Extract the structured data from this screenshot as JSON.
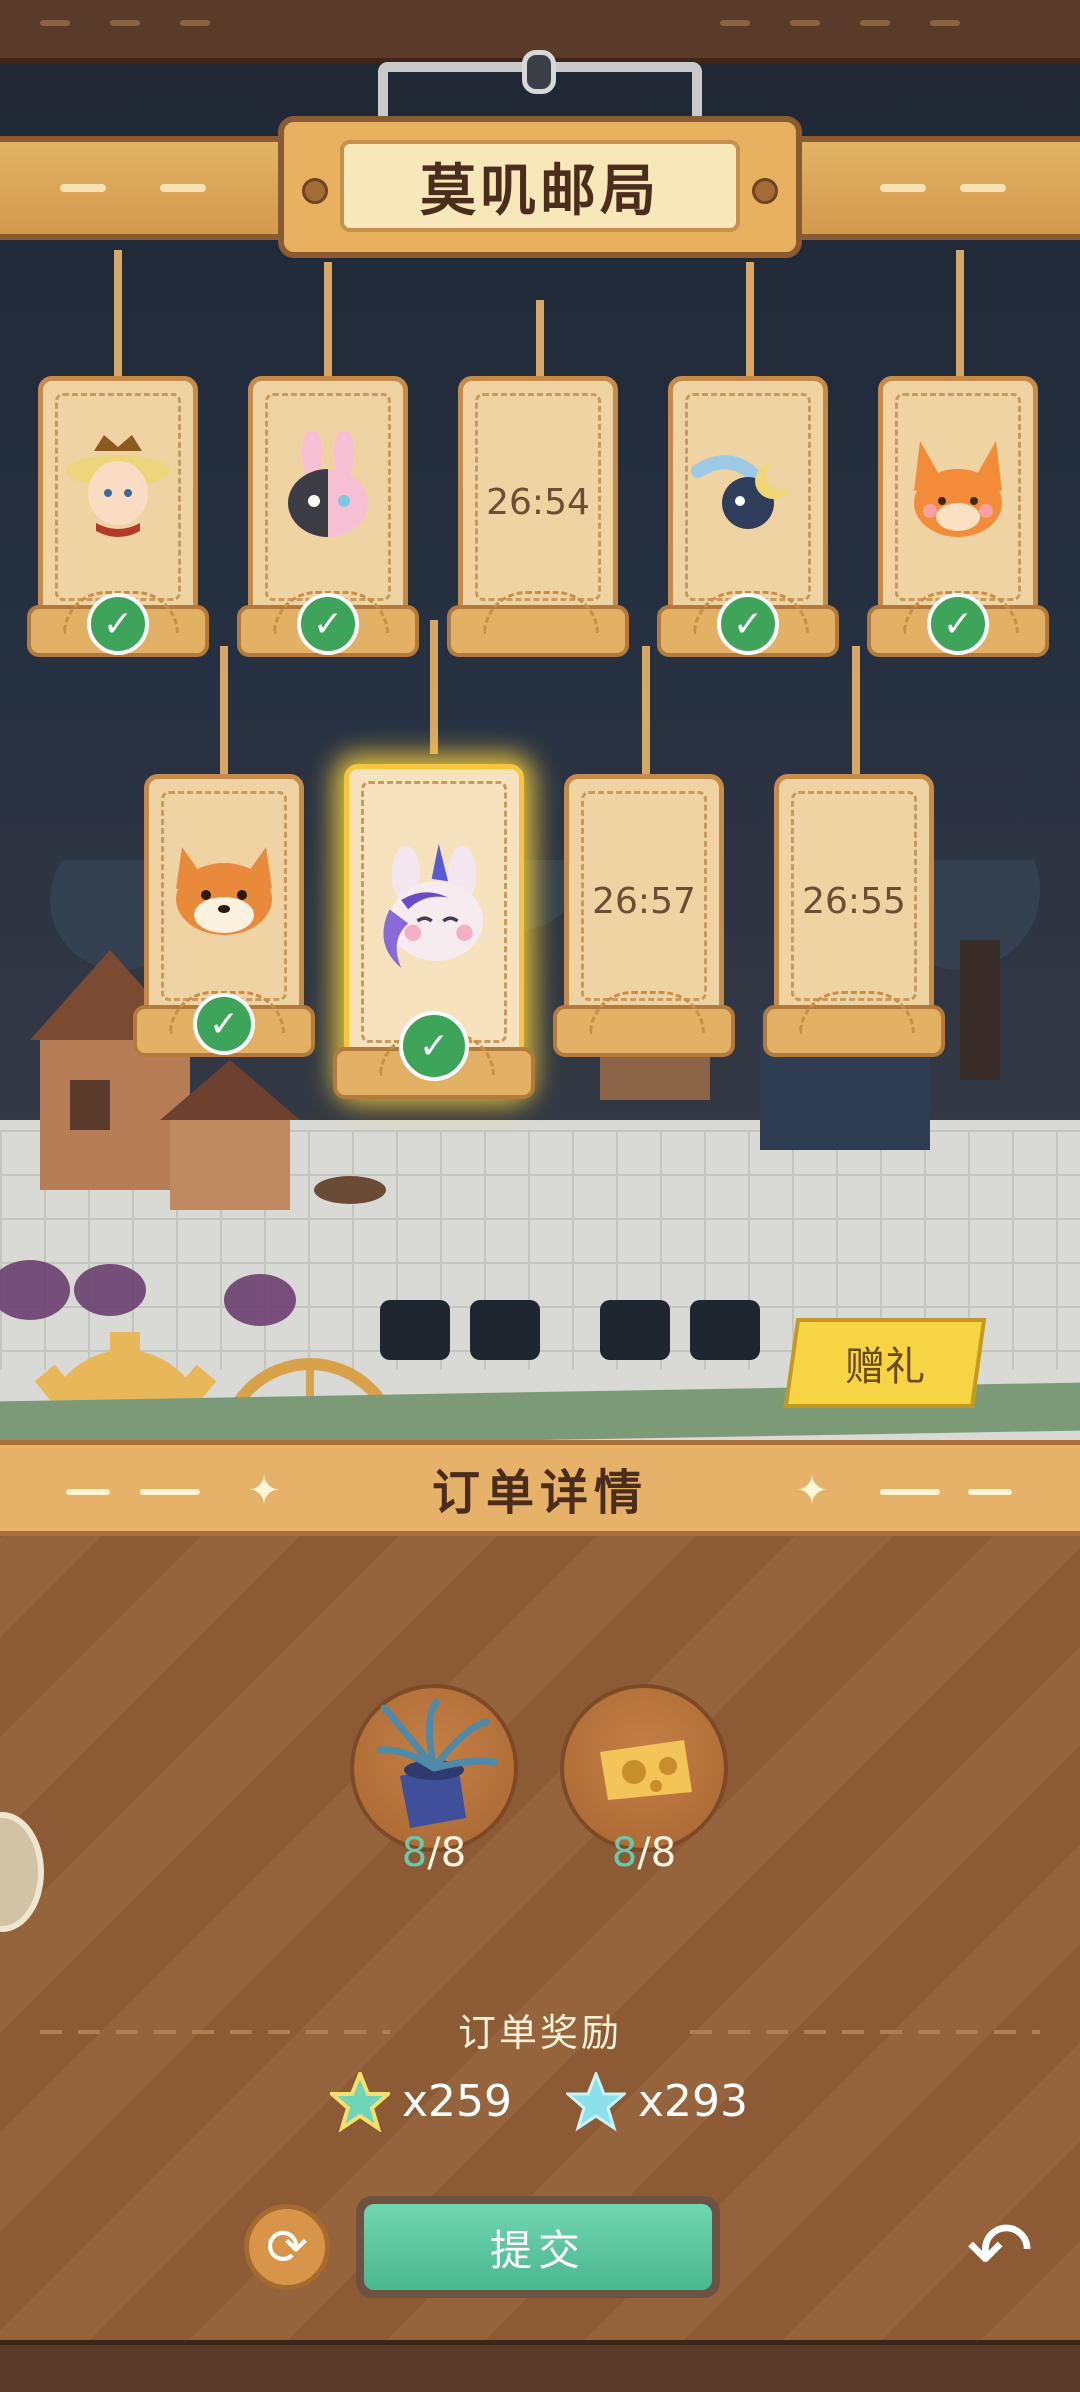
{
  "header": {
    "title": "莫叽邮局"
  },
  "orders": {
    "row1": [
      {
        "character": "straw-hat-boy",
        "status": "done",
        "timer": ""
      },
      {
        "character": "bunny-pink-black",
        "status": "done",
        "timer": ""
      },
      {
        "character": "",
        "status": "waiting",
        "timer": "26:54"
      },
      {
        "character": "moon-bird",
        "status": "done",
        "timer": ""
      },
      {
        "character": "orange-fox",
        "status": "done",
        "timer": ""
      }
    ],
    "row2": [
      {
        "character": "shiba-dog",
        "status": "done",
        "timer": ""
      },
      {
        "character": "unicorn-bunny",
        "status": "done",
        "timer": "",
        "selected": true
      },
      {
        "character": "",
        "status": "waiting",
        "timer": "26:57"
      },
      {
        "character": "",
        "status": "waiting",
        "timer": "26:55"
      }
    ]
  },
  "gift_button": {
    "label": "赠礼"
  },
  "details": {
    "title": "订单详情",
    "items": [
      {
        "icon": "potted-plant-icon",
        "have": "8",
        "need": "/8"
      },
      {
        "icon": "cheese-block-icon",
        "have": "8",
        "need": "/8"
      }
    ],
    "rewards_title": "订单奖励",
    "rewards": [
      {
        "icon": "rainbow-star-icon",
        "value": "x259"
      },
      {
        "icon": "blue-star-icon",
        "value": "x293"
      }
    ]
  },
  "actions": {
    "submit_label": "提交",
    "refresh_icon": "refresh-icon",
    "back_icon": "undo-arrow-icon"
  },
  "colors": {
    "check": "#3ea45a",
    "submit": "#4bb790",
    "glow": "#f5c73c"
  }
}
